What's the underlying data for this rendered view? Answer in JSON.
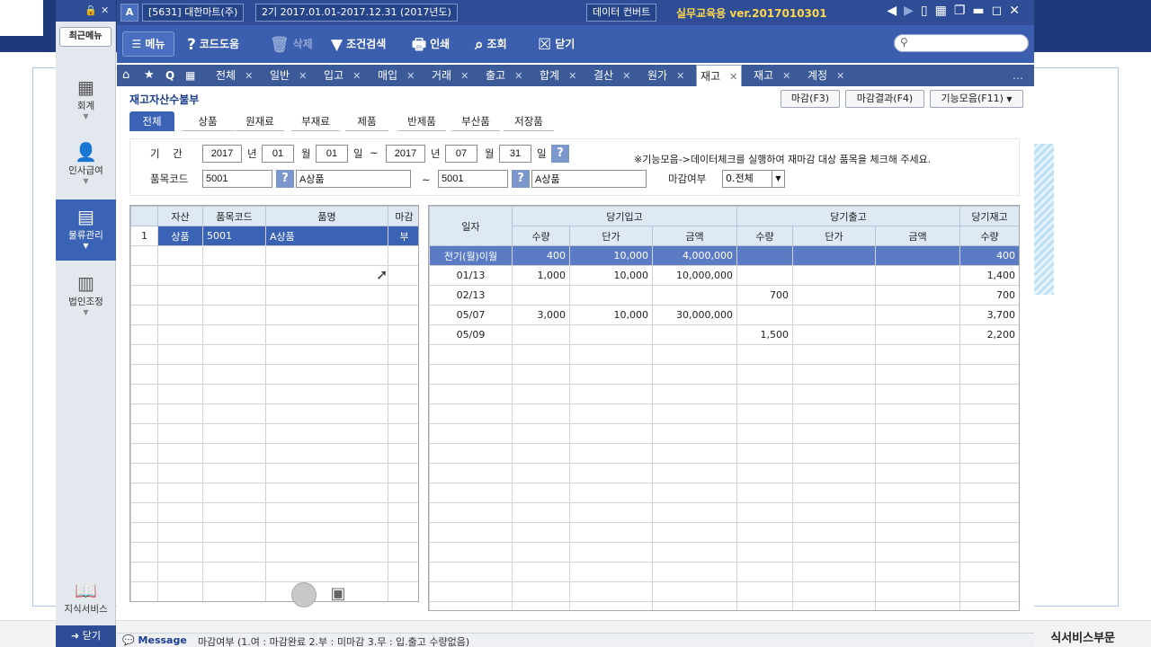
{
  "desktop": {
    "footer_text": "식서비스부문"
  },
  "sidebar": {
    "recent_label": "최근메뉴",
    "items": [
      {
        "label": "회계",
        "icon": "calculator-icon"
      },
      {
        "label": "인사급여",
        "icon": "person-icon"
      },
      {
        "label": "물류관리",
        "icon": "warehouse-icon",
        "active": true
      },
      {
        "label": "법인조정",
        "icon": "building-icon"
      }
    ],
    "knowledge_label": "지식서비스",
    "close_label": "닫기"
  },
  "titlebar": {
    "app_badge": "A",
    "company": "[5631] 대한마트(주)",
    "period": "2기  2017.01.01-2017.12.31  (2017년도)",
    "data_convert": "데이터 컨버트",
    "version": "실무교육용  ver.2017010301"
  },
  "toolbar": {
    "menu": "메뉴",
    "code_help": "코드도움",
    "delete": "삭제",
    "condition_search": "조건검색",
    "print": "인쇄",
    "view": "조회",
    "close": "닫기",
    "search_placeholder": ""
  },
  "tabs": [
    {
      "label": "전체"
    },
    {
      "label": "일반"
    },
    {
      "label": "입고"
    },
    {
      "label": "매입"
    },
    {
      "label": "거래"
    },
    {
      "label": "출고"
    },
    {
      "label": "합계"
    },
    {
      "label": "결산"
    },
    {
      "label": "원가"
    },
    {
      "label": "재고",
      "active": true
    },
    {
      "label": "재고"
    },
    {
      "label": "계정"
    }
  ],
  "page": {
    "title": "재고자산수불부",
    "btn_close_month": "마감(F3)",
    "btn_close_result": "마감결과(F4)",
    "btn_functions": "기능모음(F11)"
  },
  "subtabs": [
    {
      "label": "전체",
      "active": true
    },
    {
      "label": "상품"
    },
    {
      "label": "원재료"
    },
    {
      "label": "부재료"
    },
    {
      "label": "제품"
    },
    {
      "label": "반제품"
    },
    {
      "label": "부산품"
    },
    {
      "label": "저장품"
    }
  ],
  "filter": {
    "period_label": "기    간",
    "from_year": "2017",
    "from_month": "01",
    "from_day": "01",
    "to_year": "2017",
    "to_month": "07",
    "to_day": "31",
    "year_unit": "년",
    "month_unit": "월",
    "day_unit": "일",
    "tilde": "~",
    "item_code_label": "품목코드",
    "code_from": "5001",
    "name_from": "A상품",
    "code_to": "5001",
    "name_to": "A상품",
    "closed_label": "마감여부",
    "closed_value": "0.전체",
    "notice": "※기능모음->데이터체크를 실행하여 재마감 대상 품목을 체크해 주세요."
  },
  "left_grid": {
    "headers": [
      "자산",
      "품목코드",
      "품명",
      "마감"
    ],
    "rows": [
      {
        "no": "1",
        "asset": "상품",
        "code": "5001",
        "name": "A상품",
        "closed": "부"
      }
    ]
  },
  "right_grid": {
    "header_date": "일자",
    "group_in": "당기입고",
    "group_out": "당기출고",
    "group_stock": "당기재고",
    "sub_qty": "수량",
    "sub_price": "단가",
    "sub_amount": "금액",
    "rows": [
      {
        "date": "전기(월)이월",
        "in_qty": "400",
        "in_price": "10,000",
        "in_amt": "4,000,000",
        "out_qty": "",
        "out_price": "",
        "out_amt": "",
        "stock": "400"
      },
      {
        "date": "01/13",
        "in_qty": "1,000",
        "in_price": "10,000",
        "in_amt": "10,000,000",
        "out_qty": "",
        "out_price": "",
        "out_amt": "",
        "stock": "1,400"
      },
      {
        "date": "02/13",
        "in_qty": "",
        "in_price": "",
        "in_amt": "",
        "out_qty": "700",
        "out_price": "",
        "out_amt": "",
        "stock": "700"
      },
      {
        "date": "05/07",
        "in_qty": "3,000",
        "in_price": "10,000",
        "in_amt": "30,000,000",
        "out_qty": "",
        "out_price": "",
        "out_amt": "",
        "stock": "3,700"
      },
      {
        "date": "05/09",
        "in_qty": "",
        "in_price": "",
        "in_amt": "",
        "out_qty": "1,500",
        "out_price": "",
        "out_amt": "",
        "stock": "2,200"
      }
    ]
  },
  "statusbar": {
    "label": "Message",
    "text": "마감여부 (1.여 : 마감완료 2.부 : 미마감 3.무 : 입.출고 수량없음)"
  }
}
